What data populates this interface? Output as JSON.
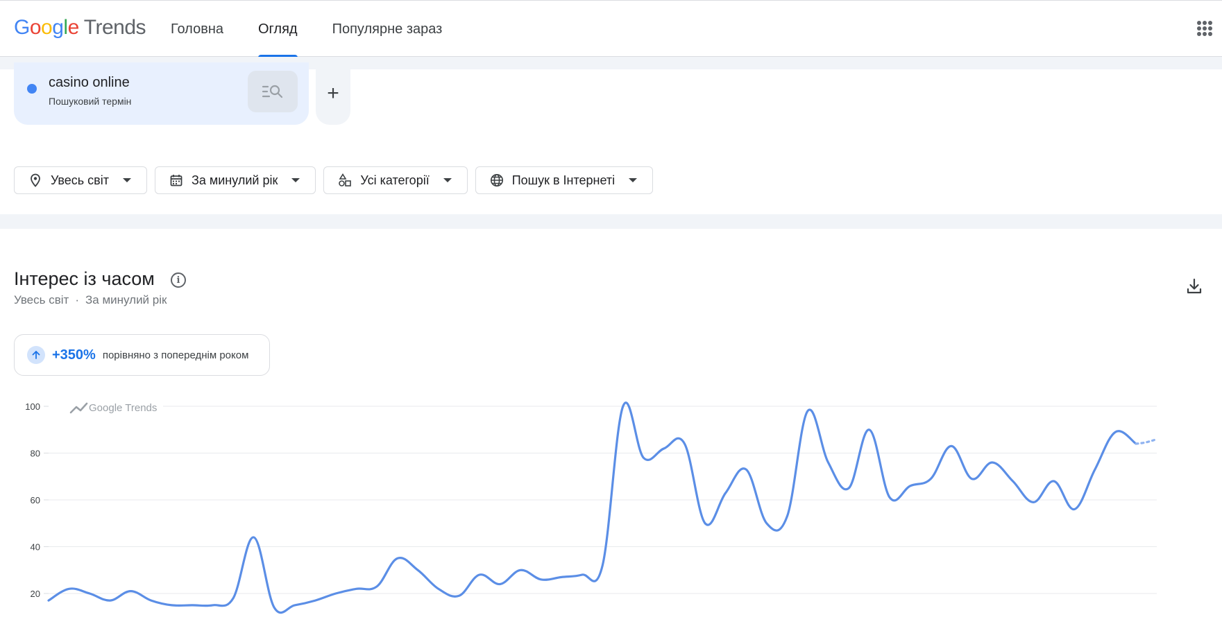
{
  "header": {
    "logo_letters": [
      "G",
      "o",
      "o",
      "g",
      "l",
      "e"
    ],
    "logo_product": "Trends",
    "tabs": [
      {
        "label": "Головна",
        "active": false
      },
      {
        "label": "Огляд",
        "active": true
      },
      {
        "label": "Популярне зараз",
        "active": false
      }
    ],
    "apps_icon": "apps-grid-icon"
  },
  "term": {
    "name": "casino online",
    "type": "Пошуковий термін",
    "color": "#4285f4",
    "search_icon": "search-list-icon",
    "add_icon": "+"
  },
  "filters": {
    "location": "Увесь світ",
    "time": "За минулий рік",
    "category": "Усі категорії",
    "source": "Пошук в Інтернеті"
  },
  "section": {
    "title": "Інтерес із часом",
    "sub_location": "Увесь світ",
    "sub_separator": "·",
    "sub_time": "За минулий рік",
    "change_pct": "+350%",
    "change_text": "порівняно з попереднім роком"
  },
  "chart_data": {
    "type": "line",
    "watermark": "Google Trends",
    "ylim": [
      10,
      100
    ],
    "yticks": [
      100,
      80,
      60,
      40,
      20
    ],
    "grid": true,
    "color": "#5b8ee6",
    "series": [
      {
        "values": [
          17,
          22,
          20,
          17,
          21,
          17,
          15,
          15,
          15,
          18,
          44,
          14,
          15,
          17,
          20,
          22,
          23,
          35,
          30,
          22,
          19,
          28,
          24,
          30,
          26,
          27,
          28,
          32,
          100,
          78,
          82,
          84,
          50,
          63,
          73,
          50,
          53,
          98,
          76,
          65,
          90,
          61,
          66,
          69,
          83,
          69,
          76,
          68,
          59,
          68,
          56,
          73,
          89,
          84
        ],
        "partial_last": 86
      }
    ]
  }
}
